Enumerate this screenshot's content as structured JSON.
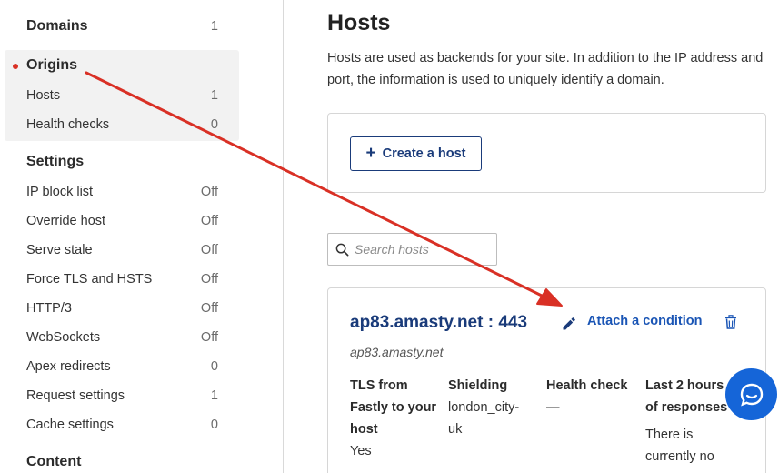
{
  "sidebar": {
    "domains": {
      "label": "Domains",
      "count": "1"
    },
    "origins": {
      "label": "Origins",
      "items": [
        {
          "label": "Hosts",
          "value": "1"
        },
        {
          "label": "Health checks",
          "value": "0"
        }
      ]
    },
    "settings": {
      "label": "Settings",
      "items": [
        {
          "label": "IP block list",
          "value": "Off"
        },
        {
          "label": "Override host",
          "value": "Off"
        },
        {
          "label": "Serve stale",
          "value": "Off"
        },
        {
          "label": "Force TLS and HSTS",
          "value": "Off"
        },
        {
          "label": "HTTP/3",
          "value": "Off"
        },
        {
          "label": "WebSockets",
          "value": "Off"
        },
        {
          "label": "Apex redirects",
          "value": "0"
        },
        {
          "label": "Request settings",
          "value": "1"
        },
        {
          "label": "Cache settings",
          "value": "0"
        }
      ]
    },
    "content": {
      "label": "Content"
    }
  },
  "main": {
    "title": "Hosts",
    "description": "Hosts are used as backends for your site. In addition to the IP address and port, the information is used to uniquely identify a domain.",
    "create_button": "Create a host",
    "search_placeholder": "Search hosts",
    "host": {
      "title": "ap83.amasty.net : 443",
      "subtitle": "ap83.amasty.net",
      "attach_label": "Attach a condition",
      "columns": [
        {
          "header_lines": [
            "TLS from",
            "Fastly to your",
            "host"
          ],
          "value_lines": [
            "Yes"
          ]
        },
        {
          "header_lines": [
            "Shielding"
          ],
          "value_lines": [
            "london_city-",
            "uk"
          ]
        },
        {
          "header_lines": [
            "Health check"
          ],
          "value_lines": [
            "—"
          ]
        },
        {
          "header_lines": [
            "Last 2 hours",
            "of responses"
          ],
          "value_lines": [
            "There is",
            "currently no"
          ]
        }
      ]
    }
  },
  "icons": {
    "edit": "pencil-icon",
    "delete": "trash-icon",
    "search": "search-icon",
    "chat": "chat-icon",
    "plus": "plus-icon"
  },
  "colors": {
    "brand_blue": "#1a3b7a",
    "link_blue": "#1a55b5",
    "chat_blue": "#1565d8",
    "annotation_red": "#d93025",
    "active_panel": "#f2f2f2"
  }
}
